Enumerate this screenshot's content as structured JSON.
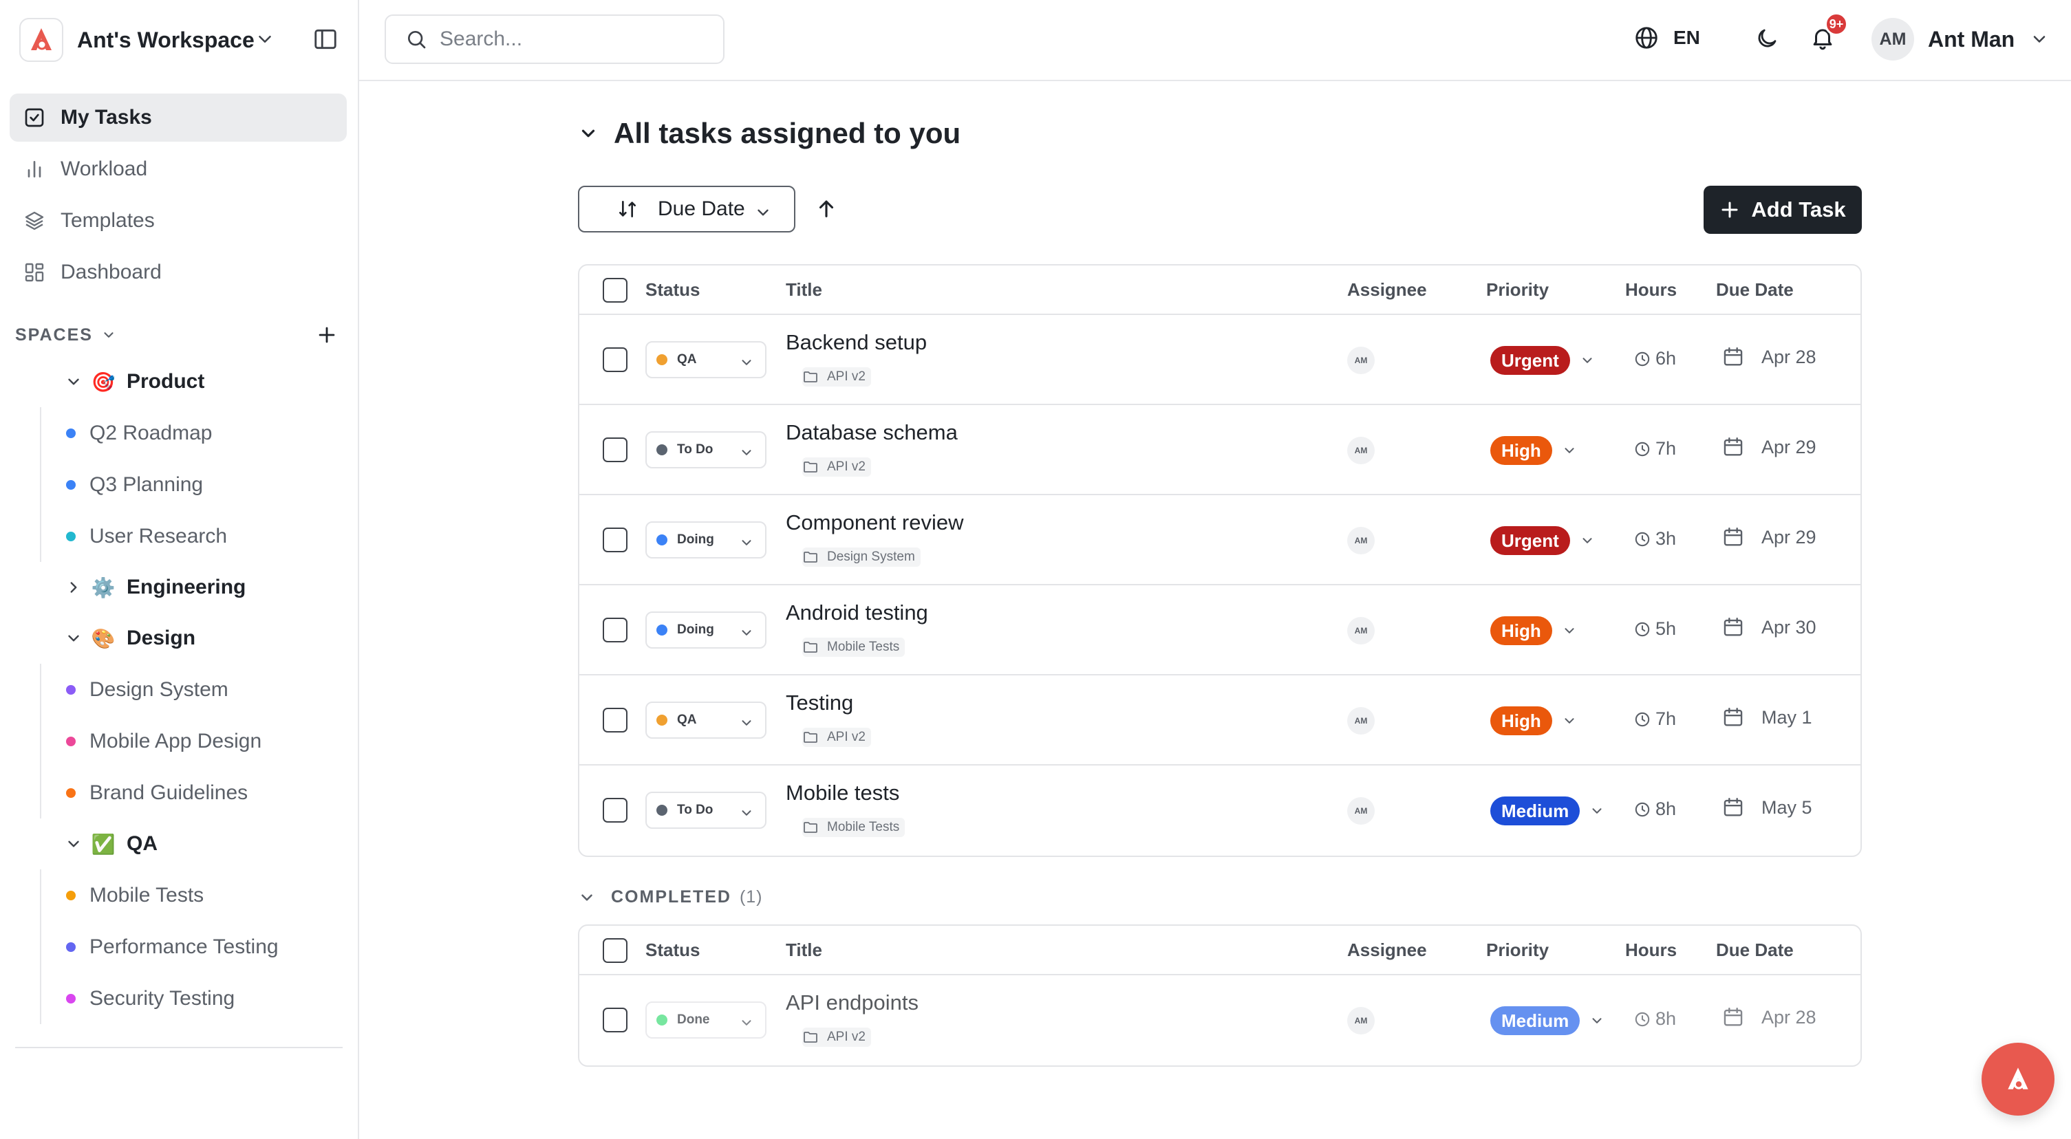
{
  "workspace": {
    "name": "Ant's Workspace"
  },
  "nav": {
    "items": [
      {
        "label": "My Tasks",
        "icon": "check-square-icon",
        "active": true
      },
      {
        "label": "Workload",
        "icon": "bar-chart-icon",
        "active": false
      },
      {
        "label": "Templates",
        "icon": "layers-icon",
        "active": false
      },
      {
        "label": "Dashboard",
        "icon": "dashboard-icon",
        "active": false
      }
    ]
  },
  "spaces": {
    "label": "SPACES",
    "list": [
      {
        "name": "Product",
        "emoji": "🎯",
        "expanded": true,
        "projects": [
          {
            "name": "Q2 Roadmap",
            "color": "#3b82f6"
          },
          {
            "name": "Q3 Planning",
            "color": "#3b82f6"
          },
          {
            "name": "User Research",
            "color": "#22b8cf"
          }
        ]
      },
      {
        "name": "Engineering",
        "emoji": "⚙️",
        "expanded": false,
        "projects": []
      },
      {
        "name": "Design",
        "emoji": "🎨",
        "expanded": true,
        "projects": [
          {
            "name": "Design System",
            "color": "#8b5cf6"
          },
          {
            "name": "Mobile App Design",
            "color": "#ec4899"
          },
          {
            "name": "Brand Guidelines",
            "color": "#f97316"
          }
        ]
      },
      {
        "name": "QA",
        "emoji": "✅",
        "expanded": true,
        "projects": [
          {
            "name": "Mobile Tests",
            "color": "#f59e0b"
          },
          {
            "name": "Performance Testing",
            "color": "#6366f1"
          },
          {
            "name": "Security Testing",
            "color": "#d946ef"
          }
        ]
      }
    ]
  },
  "topbar": {
    "search_placeholder": "Search...",
    "language": "EN",
    "notification_badge": "9+",
    "user_initials": "AM",
    "user_name": "Ant Man"
  },
  "main": {
    "title": "All tasks assigned to you",
    "sort_label": "Due Date",
    "add_task_label": "Add Task",
    "columns": {
      "status": "Status",
      "title": "Title",
      "assignee": "Assignee",
      "priority": "Priority",
      "hours": "Hours",
      "due": "Due Date"
    },
    "tasks": [
      {
        "status": "QA",
        "status_color": "#f0a030",
        "title": "Backend setup",
        "project": "API v2",
        "assignee": "AM",
        "priority": "Urgent",
        "priority_color": "#b91c1c",
        "hours": "6h",
        "due": "Apr 28"
      },
      {
        "status": "To Do",
        "status_color": "#5b6470",
        "title": "Database schema",
        "project": "API v2",
        "assignee": "AM",
        "priority": "High",
        "priority_color": "#ea580c",
        "hours": "7h",
        "due": "Apr 29"
      },
      {
        "status": "Doing",
        "status_color": "#3b82f6",
        "title": "Component review",
        "project": "Design System",
        "assignee": "AM",
        "priority": "Urgent",
        "priority_color": "#b91c1c",
        "hours": "3h",
        "due": "Apr 29"
      },
      {
        "status": "Doing",
        "status_color": "#3b82f6",
        "title": "Android testing",
        "project": "Mobile Tests",
        "assignee": "AM",
        "priority": "High",
        "priority_color": "#ea580c",
        "hours": "5h",
        "due": "Apr 30"
      },
      {
        "status": "QA",
        "status_color": "#f0a030",
        "title": "Testing",
        "project": "API v2",
        "assignee": "AM",
        "priority": "High",
        "priority_color": "#ea580c",
        "hours": "7h",
        "due": "May 1"
      },
      {
        "status": "To Do",
        "status_color": "#5b6470",
        "title": "Mobile tests",
        "project": "Mobile Tests",
        "assignee": "AM",
        "priority": "Medium",
        "priority_color": "#1d4ed8",
        "hours": "8h",
        "due": "May 5"
      }
    ],
    "completed": {
      "label": "COMPLETED",
      "count": "(1)",
      "tasks": [
        {
          "status": "Done",
          "status_color": "#4ade80",
          "title": "API endpoints",
          "project": "API v2",
          "assignee": "AM",
          "priority": "Medium",
          "priority_color": "#2563eb",
          "hours": "8h",
          "due": "Apr 28"
        }
      ]
    }
  }
}
